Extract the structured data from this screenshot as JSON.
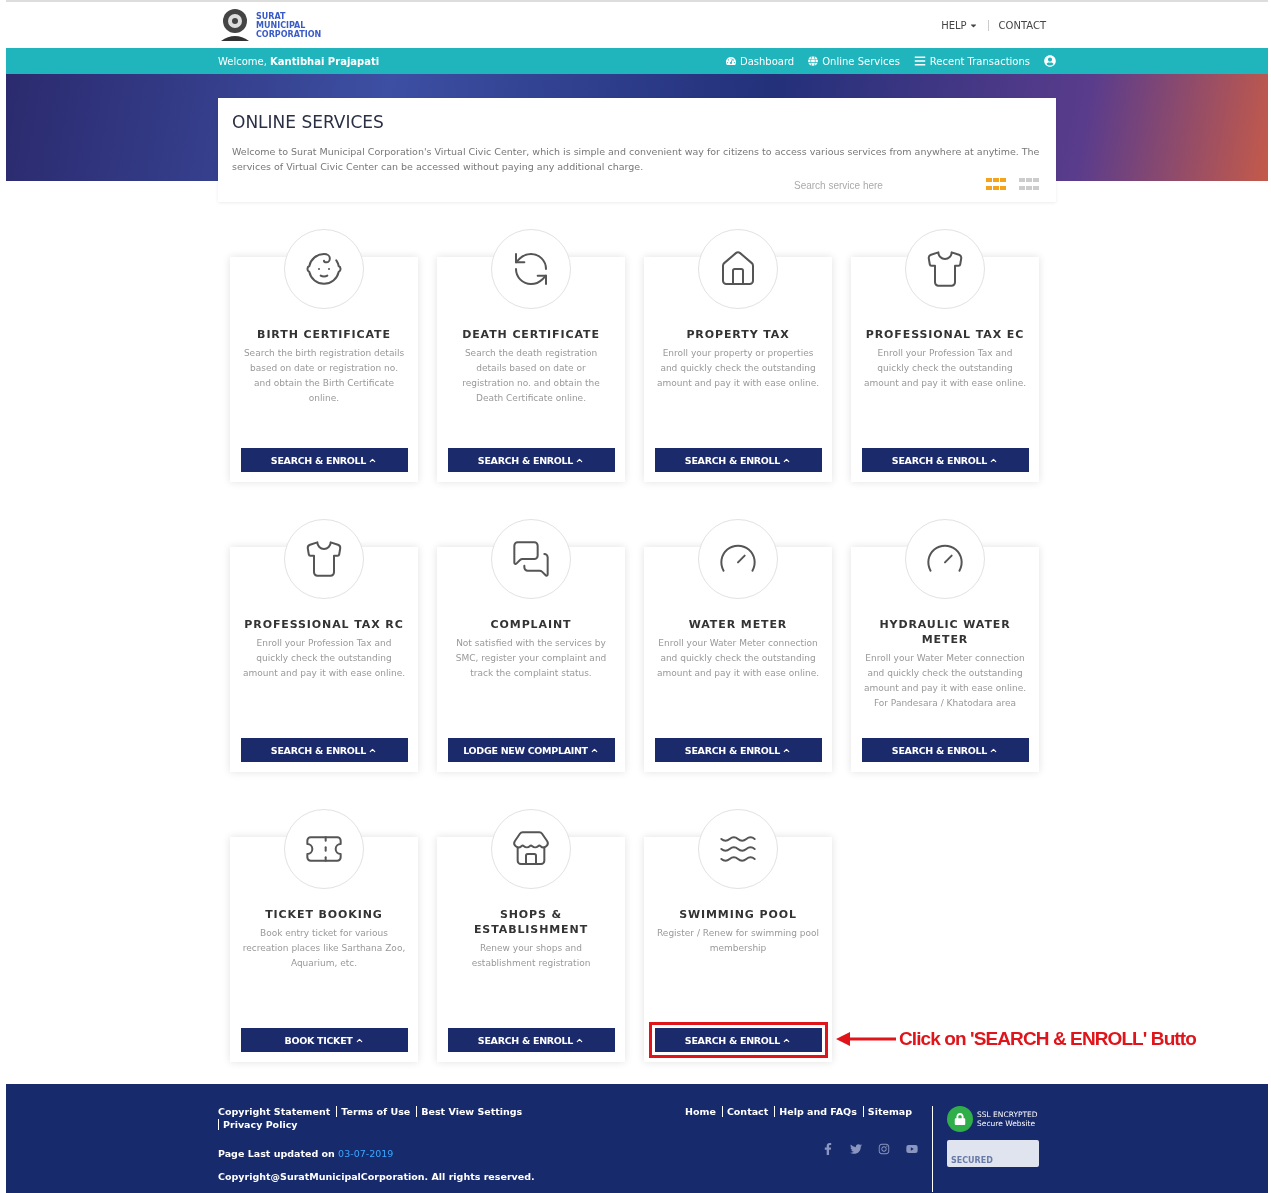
{
  "header": {
    "logo_lines": [
      "SURAT",
      "MUNICIPAL",
      "CORPORATION"
    ],
    "links": [
      {
        "label": "HELP",
        "dropdown": true
      },
      {
        "label": "CONTACT",
        "dropdown": false
      }
    ]
  },
  "navbar": {
    "welcome": "Welcome, **Kantibhai Prajapati**",
    "items": [
      {
        "label": "Dashboard",
        "kind": "dashboard"
      },
      {
        "label": "Online Services",
        "kind": "globe"
      },
      {
        "label": "Recent Transactions",
        "kind": "list"
      }
    ]
  },
  "intro": {
    "title": "ONLINE SERVICES",
    "text": "Welcome to Surat Municipal Corporation's Virtual Civic Center, which is simple and convenient way for citizens to access various services from anywhere at anytime. The services of Virtual Civic Center can be accessed without paying any additional charge.",
    "search": {
      "placeholder": "Search service here"
    },
    "view_toggle": [
      {
        "selected": true
      },
      {
        "selected": false
      }
    ]
  },
  "services": [
    {
      "title": "BIRTH CERTIFICATE",
      "description": "Search the birth registration details based on date or registration no. and obtain the Birth Certificate online.",
      "button": "SEARCH & ENROLL",
      "kind": "baby",
      "highlighted": false
    },
    {
      "title": "DEATH CERTIFICATE",
      "description": "Search the death registration details based on date or registration no. and obtain the Death Certificate online.",
      "button": "SEARCH & ENROLL",
      "kind": "cycle",
      "highlighted": false
    },
    {
      "title": "PROPERTY TAX",
      "description": "Enroll your property or properties and quickly check the outstanding amount and pay it with ease online.",
      "button": "SEARCH & ENROLL",
      "kind": "house",
      "highlighted": false
    },
    {
      "title": "PROFESSIONAL TAX EC",
      "description": "Enroll your Profession Tax and quickly check the outstanding amount and pay it with ease online.",
      "button": "SEARCH & ENROLL",
      "kind": "suit",
      "highlighted": false
    },
    {
      "title": "PROFESSIONAL TAX RC",
      "description": "Enroll your Profession Tax and quickly check the outstanding amount and pay it with ease online.",
      "button": "SEARCH & ENROLL",
      "kind": "suit",
      "highlighted": false
    },
    {
      "title": "COMPLAINT",
      "description": "Not satisfied with the services by SMC, register your complaint and track the complaint status.",
      "button": "LODGE NEW COMPLAINT",
      "kind": "chat",
      "highlighted": false
    },
    {
      "title": "WATER METER",
      "description": "Enroll your Water Meter connection and quickly check the outstanding amount and pay it with ease online.",
      "button": "SEARCH & ENROLL",
      "kind": "tap",
      "highlighted": false
    },
    {
      "title": "HYDRAULIC WATER METER",
      "description": "Enroll your Water Meter connection and quickly check the outstanding amount and pay it with ease online. For Pandesara / Khatodara area",
      "button": "SEARCH & ENROLL",
      "kind": "tap",
      "highlighted": false
    },
    {
      "title": "TICKET BOOKING",
      "description": "Book entry ticket for various recreation places like Sarthana Zoo, Aquarium, etc.",
      "button": "BOOK TICKET",
      "kind": "ticket",
      "highlighted": false
    },
    {
      "title": "SHOPS & ESTABLISHMENT",
      "description": "Renew your shops and establishment registration",
      "button": "SEARCH & ENROLL",
      "kind": "shop",
      "highlighted": false
    },
    {
      "title": "SWIMMING POOL",
      "description": "Register / Renew for swimming pool membership",
      "button": "SEARCH & ENROLL",
      "kind": "pool",
      "highlighted": true
    }
  ],
  "annotation": {
    "text": "Click on 'SEARCH & ENROLL' Butto"
  },
  "footer": {
    "links_left": [
      "Copyright Statement",
      "Terms of Use",
      "Best View Settings",
      "Privacy Policy"
    ],
    "links_right": [
      "Home",
      "Contact",
      "Help and FAQs",
      "Sitemap"
    ],
    "updated_label": "Page Last updated on",
    "updated_date": "03-07-2019",
    "copyright": "Copyright@SuratMunicipalCorporation. All rights reserved.",
    "ssl_lines": [
      "SSL ENCRYPTED",
      "Secure Website"
    ],
    "seal_text": "SECURED",
    "social": [
      {
        "kind": "facebook"
      },
      {
        "kind": "twitter"
      },
      {
        "kind": "instagram"
      },
      {
        "kind": "youtube"
      }
    ]
  }
}
